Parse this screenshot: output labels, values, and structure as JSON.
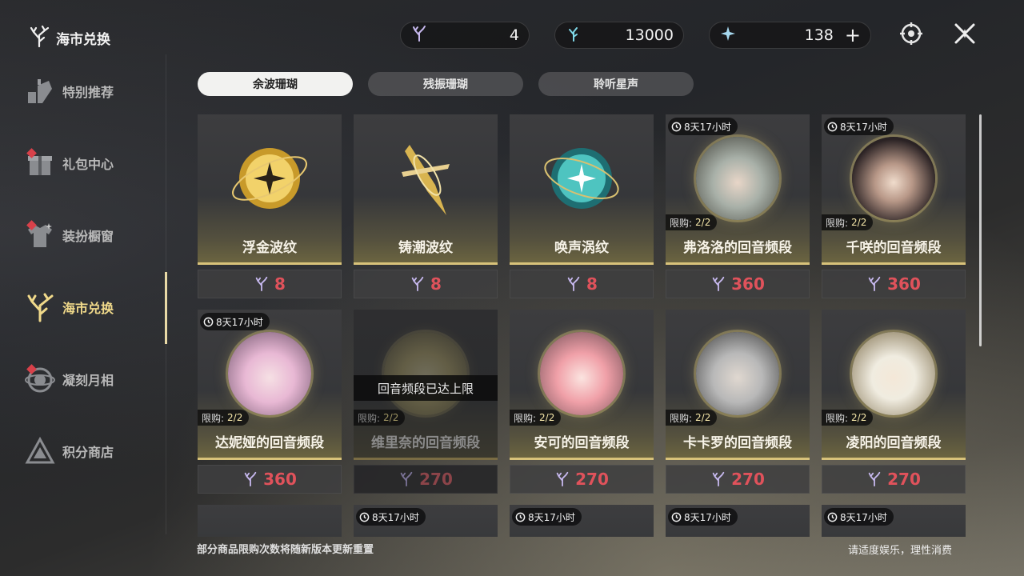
{
  "sidebar": {
    "title": "海市兑换",
    "items": [
      {
        "label": "特别推荐",
        "icon": "recommend-icon",
        "badge": false
      },
      {
        "label": "礼包中心",
        "icon": "gift-icon",
        "badge": true
      },
      {
        "label": "装扮橱窗",
        "icon": "outfit-icon",
        "badge": true
      },
      {
        "label": "海市兑换",
        "icon": "coral-icon",
        "badge": false,
        "active": true
      },
      {
        "label": "凝刻月相",
        "icon": "moon-icon",
        "badge": true
      },
      {
        "label": "积分商店",
        "icon": "triangle-icon",
        "badge": false
      }
    ]
  },
  "currencies": [
    {
      "icon": "afterglow-coral-icon",
      "value": "4"
    },
    {
      "icon": "oscillated-coral-icon",
      "value": "13000"
    },
    {
      "icon": "lunite-icon",
      "value": "138",
      "plus": "+"
    }
  ],
  "top_icons": [
    "target-icon",
    "close-icon"
  ],
  "tabs": [
    {
      "label": "余波珊瑚",
      "active": true
    },
    {
      "label": "残振珊瑚",
      "active": false
    },
    {
      "label": "聆听星声",
      "active": false
    }
  ],
  "colors": {
    "accent_gold": "#d8c27a",
    "price_red": "#e0525b",
    "active_nav": "#f0d98a"
  },
  "items": [
    {
      "name": "浮金波纹",
      "price": "8",
      "kind": "orb-gold"
    },
    {
      "name": "铸潮波纹",
      "price": "8",
      "kind": "blade"
    },
    {
      "name": "唤声涡纹",
      "price": "8",
      "kind": "orb-teal"
    },
    {
      "name": "弗洛洛的回音频段",
      "price": "360",
      "timer": "8天17小时",
      "limit_label": "限购:",
      "limit": "2/2",
      "hair": "#a8b0a8"
    },
    {
      "name": "千咲的回音频段",
      "price": "360",
      "timer": "8天17小时",
      "limit_label": "限购:",
      "limit": "2/2",
      "hair": "#2a2224"
    },
    {
      "name": "达妮娅的回音频段",
      "price": "360",
      "timer": "8天17小时",
      "limit_label": "限购:",
      "limit": "2/2",
      "hair": "#e8b8d4"
    },
    {
      "name": "维里奈的回音频段",
      "price": "270",
      "limit_label": "限购:",
      "limit": "2/2",
      "overlay": "回音频段已达上限",
      "dim": true,
      "hair": "#c8b870"
    },
    {
      "name": "安可的回音频段",
      "price": "270",
      "limit_label": "限购:",
      "limit": "2/2",
      "hair": "#f0a0a8"
    },
    {
      "name": "卡卡罗的回音频段",
      "price": "270",
      "limit_label": "限购:",
      "limit": "2/2",
      "hair": "#d8d8d8"
    },
    {
      "name": "凌阳的回音频段",
      "price": "270",
      "limit_label": "限购:",
      "limit": "2/2",
      "hair": "#f0ece0"
    }
  ],
  "row3_timers": [
    "",
    "8天17小时",
    "8天17小时",
    "8天17小时",
    "8天17小时"
  ],
  "footer": {
    "note": "部分商品限购次数将随新版本更新重置",
    "right": "请适度娱乐，理性消费"
  }
}
